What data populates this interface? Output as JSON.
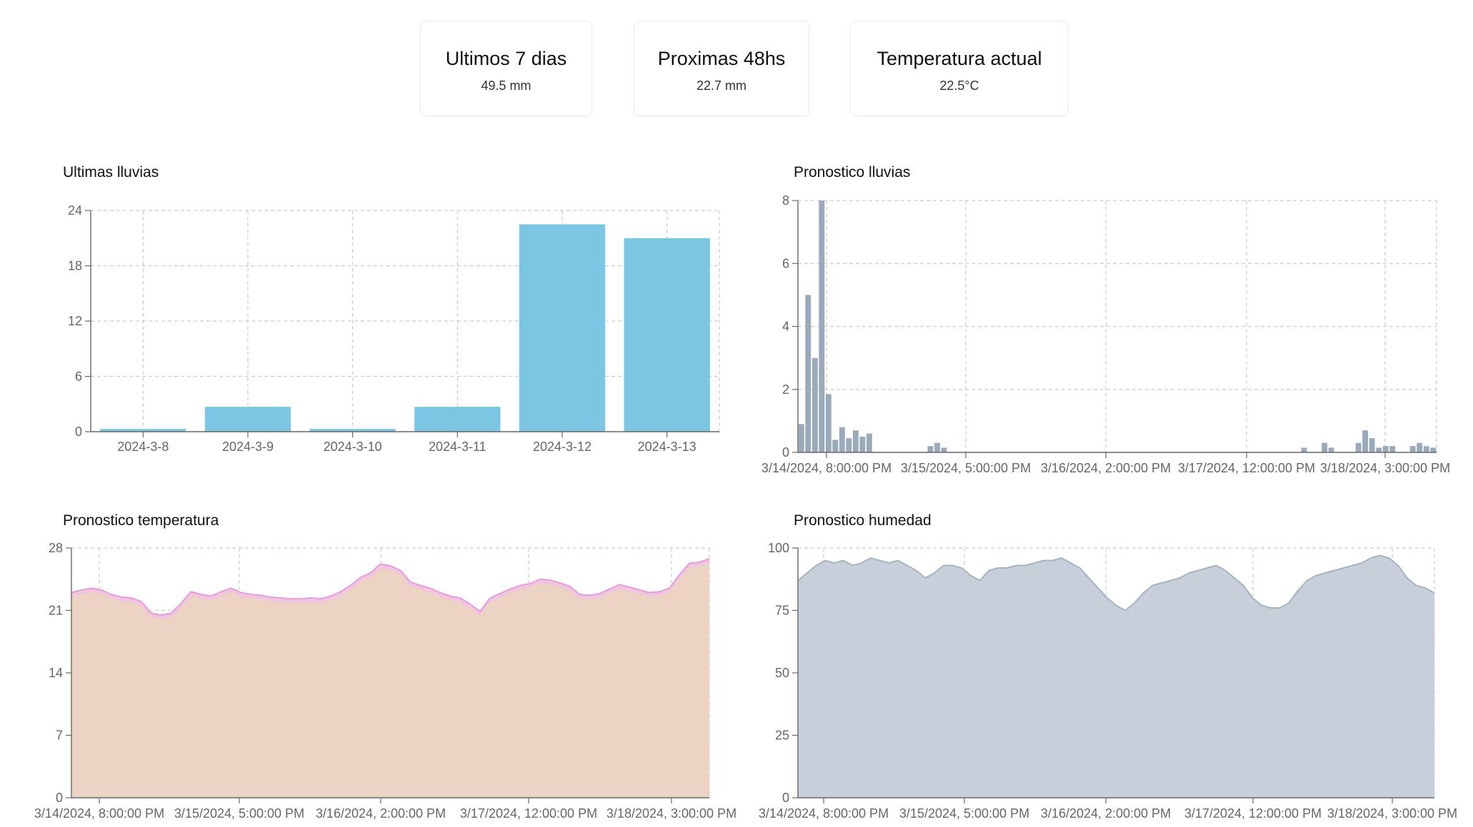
{
  "cards": [
    {
      "title": "Ultimos 7 dias",
      "value": "49.5 mm"
    },
    {
      "title": "Proximas 48hs",
      "value": "22.7 mm"
    },
    {
      "title": "Temperatura actual",
      "value": "22.5°C"
    }
  ],
  "colors": {
    "bar": "#7cc6e4",
    "rain": "#9aaabb",
    "temp_fill": "#ecd3c4",
    "temp_line": "#e79be0",
    "temp_band": "#f0c3e2",
    "hum_fill": "#c7d0da",
    "hum_line": "#a6b3c2",
    "grid": "#cccccc",
    "axis": "#666666",
    "tick_text": "#666666"
  },
  "chart_data": [
    {
      "id": "lluvias",
      "type": "bar",
      "title": "Ultimas lluvias",
      "categories": [
        "2024-3-8",
        "2024-3-9",
        "2024-3-10",
        "2024-3-11",
        "2024-3-12",
        "2024-3-13"
      ],
      "values": [
        0.3,
        2.7,
        0.3,
        2.7,
        22.5,
        21.0
      ],
      "ylim": [
        0,
        24
      ],
      "yticks": [
        0,
        6,
        12,
        18,
        24
      ],
      "grid": true
    },
    {
      "id": "pron_lluvias",
      "type": "bar",
      "title": "Pronostico lluvias",
      "xticks": [
        "3/14/2024, 8:00:00 PM",
        "3/15/2024, 5:00:00 PM",
        "3/16/2024, 2:00:00 PM",
        "3/17/2024, 12:00:00 PM",
        "3/18/2024, 3:00:00 PM"
      ],
      "values": [
        0.9,
        5.0,
        3.0,
        8.0,
        1.85,
        0.4,
        0.8,
        0.45,
        0.7,
        0.5,
        0.6,
        0,
        0,
        0,
        0,
        0,
        0,
        0,
        0,
        0.2,
        0.3,
        0.15,
        0,
        0,
        0,
        0,
        0,
        0,
        0,
        0,
        0,
        0,
        0,
        0,
        0,
        0,
        0,
        0,
        0,
        0,
        0,
        0,
        0,
        0,
        0,
        0,
        0,
        0,
        0,
        0,
        0,
        0,
        0,
        0,
        0,
        0,
        0,
        0,
        0,
        0,
        0,
        0,
        0,
        0,
        0,
        0,
        0,
        0,
        0,
        0,
        0,
        0,
        0,
        0,
        0.15,
        0,
        0,
        0.3,
        0.15,
        0,
        0,
        0,
        0.3,
        0.7,
        0.45,
        0.15,
        0.2,
        0.2,
        0,
        0,
        0.2,
        0.3,
        0.2,
        0.15
      ],
      "ylim": [
        0,
        8
      ],
      "yticks": [
        0,
        2,
        4,
        6,
        8
      ],
      "grid": true
    },
    {
      "id": "pron_temp",
      "type": "area",
      "title": "Pronostico temperatura",
      "xticks": [
        "3/14/2024, 8:00:00 PM",
        "3/15/2024, 5:00:00 PM",
        "3/16/2024, 2:00:00 PM",
        "3/17/2024, 12:00:00 PM",
        "3/18/2024, 3:00:00 PM"
      ],
      "values": [
        23.0,
        23.3,
        23.5,
        23.3,
        22.8,
        22.5,
        22.4,
        22.0,
        20.7,
        20.5,
        20.7,
        21.8,
        23.1,
        22.8,
        22.6,
        23.1,
        23.5,
        23.0,
        22.8,
        22.7,
        22.5,
        22.4,
        22.3,
        22.3,
        22.4,
        22.3,
        22.6,
        23.1,
        23.8,
        24.7,
        25.2,
        26.2,
        26.0,
        25.5,
        24.2,
        23.8,
        23.5,
        23.0,
        22.6,
        22.4,
        21.7,
        20.9,
        22.4,
        22.9,
        23.4,
        23.8,
        24.0,
        24.5,
        24.4,
        24.1,
        23.7,
        22.8,
        22.7,
        22.9,
        23.4,
        23.9,
        23.6,
        23.3,
        23.0,
        23.1,
        23.5,
        25.0,
        26.3,
        26.4,
        26.8
      ],
      "ylim": [
        0,
        28
      ],
      "yticks": [
        0,
        7,
        14,
        21,
        28
      ],
      "grid": true
    },
    {
      "id": "pron_hum",
      "type": "area",
      "title": "Pronostico humedad",
      "xticks": [
        "3/14/2024, 8:00:00 PM",
        "3/15/2024, 5:00:00 PM",
        "3/16/2024, 2:00:00 PM",
        "3/17/2024, 12:00:00 PM",
        "3/18/2024, 3:00:00 PM"
      ],
      "values": [
        87,
        90,
        93,
        95,
        94,
        95,
        93,
        94,
        96,
        95,
        94,
        95,
        93,
        91,
        88,
        90,
        93,
        93,
        92,
        89,
        87,
        91,
        92,
        92,
        93,
        93,
        94,
        95,
        95,
        96,
        94,
        92,
        88,
        84,
        80,
        77,
        75,
        78,
        82,
        85,
        86,
        87,
        88,
        90,
        91,
        92,
        93,
        91,
        88,
        85,
        80,
        77,
        76,
        76,
        78,
        83,
        87,
        89,
        90,
        91,
        92,
        93,
        94,
        96,
        97,
        96,
        93,
        88,
        85,
        84,
        82
      ],
      "ylim": [
        0,
        100
      ],
      "yticks": [
        0,
        25,
        50,
        75,
        100
      ],
      "grid": true
    }
  ]
}
